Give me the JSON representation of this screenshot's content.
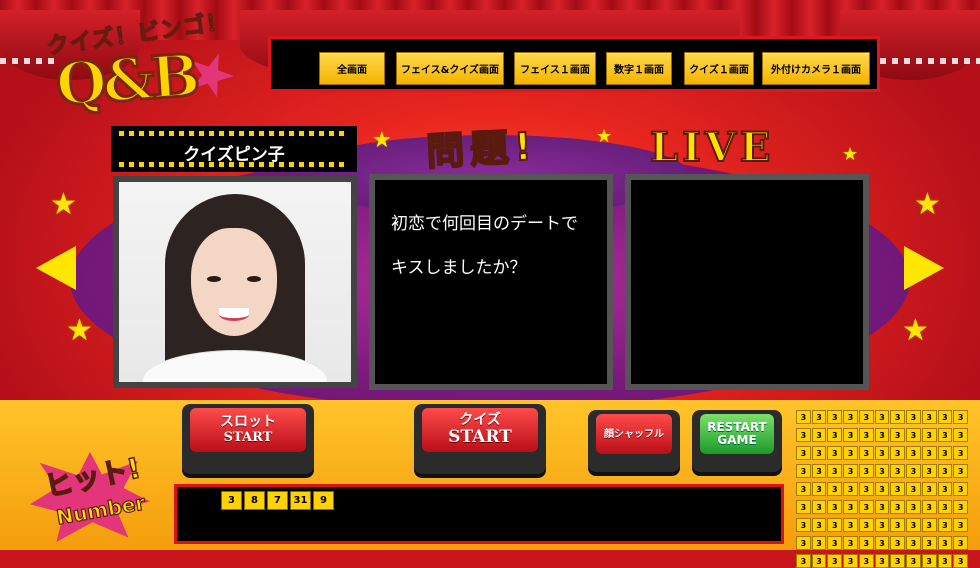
{
  "logo": {
    "top_text": "クイズ！ビンゴ！",
    "main_text": "Q&B"
  },
  "nav": {
    "buttons": [
      "全画面",
      "フェイス&クイズ画面",
      "フェイス１画面",
      "数字１画面",
      "クイズ１画面",
      "外付けカメラ１画面"
    ]
  },
  "contestant": {
    "name": "クイズピン子"
  },
  "question": {
    "title": "問題!",
    "line1": "初恋で何回目のデートで",
    "line2": "キスしましたか？"
  },
  "live": {
    "title": "LIVE"
  },
  "controls": {
    "slot_label_1": "スロット",
    "slot_label_2": "START",
    "quiz_label_1": "クイズ",
    "quiz_label_2": "START",
    "shuffle_label": "顔シャッフル",
    "restart_label_1": "RESTART",
    "restart_label_2": "GAME"
  },
  "hit": {
    "logo_text_1": "ヒット!",
    "logo_text_2": "Number",
    "numbers": [
      "3",
      "8",
      "7",
      "31",
      "9"
    ]
  },
  "number_grid": {
    "cell_value": "3",
    "rows": 9,
    "cols": 11
  },
  "colors": {
    "accent_yellow": "#ffd200",
    "curtain_red": "#c8161d",
    "button_red": "#e0161e",
    "button_green": "#1c9a2b"
  }
}
